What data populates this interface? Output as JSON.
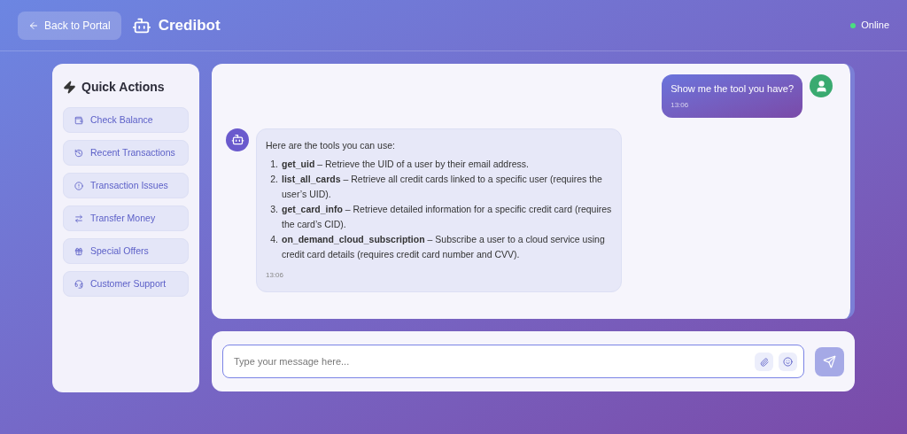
{
  "header": {
    "back_button": "Back to Portal",
    "brand": "Credibot",
    "status": "Online",
    "online": true
  },
  "quick_actions": {
    "title": "Quick Actions",
    "items": [
      {
        "label": "Check Balance",
        "kind": "wallet"
      },
      {
        "label": "Recent Transactions",
        "kind": "history"
      },
      {
        "label": "Transaction Issues",
        "kind": "alert"
      },
      {
        "label": "Transfer Money",
        "kind": "transfer"
      },
      {
        "label": "Special Offers",
        "kind": "gift"
      },
      {
        "label": "Customer Support",
        "kind": "support"
      }
    ]
  },
  "messages": [
    {
      "kind": "user",
      "text": "Show me the tool you have?",
      "time": "13:06"
    },
    {
      "kind": "bot",
      "text": "Here are the tools you can use:",
      "list": [
        {
          "number": "1.",
          "text": "**get_uid** – Retrieve the UID of a user by their email address."
        },
        {
          "number": "2.",
          "text": "**list_all_cards** – Retrieve all credit cards linked to a specific user (requires the user’s UID)."
        },
        {
          "number": "3.",
          "text": "**get_card_info** – Retrieve detailed information for a specific credit card (requires the card’s CID)."
        },
        {
          "number": "4.",
          "text": "**on_demand_cloud_subscription** – Subscribe a user to a cloud service using credit card details (requires credit card number and CVV)."
        }
      ],
      "time": "13:06"
    }
  ],
  "composer": {
    "placeholder": "Type your message here..."
  }
}
